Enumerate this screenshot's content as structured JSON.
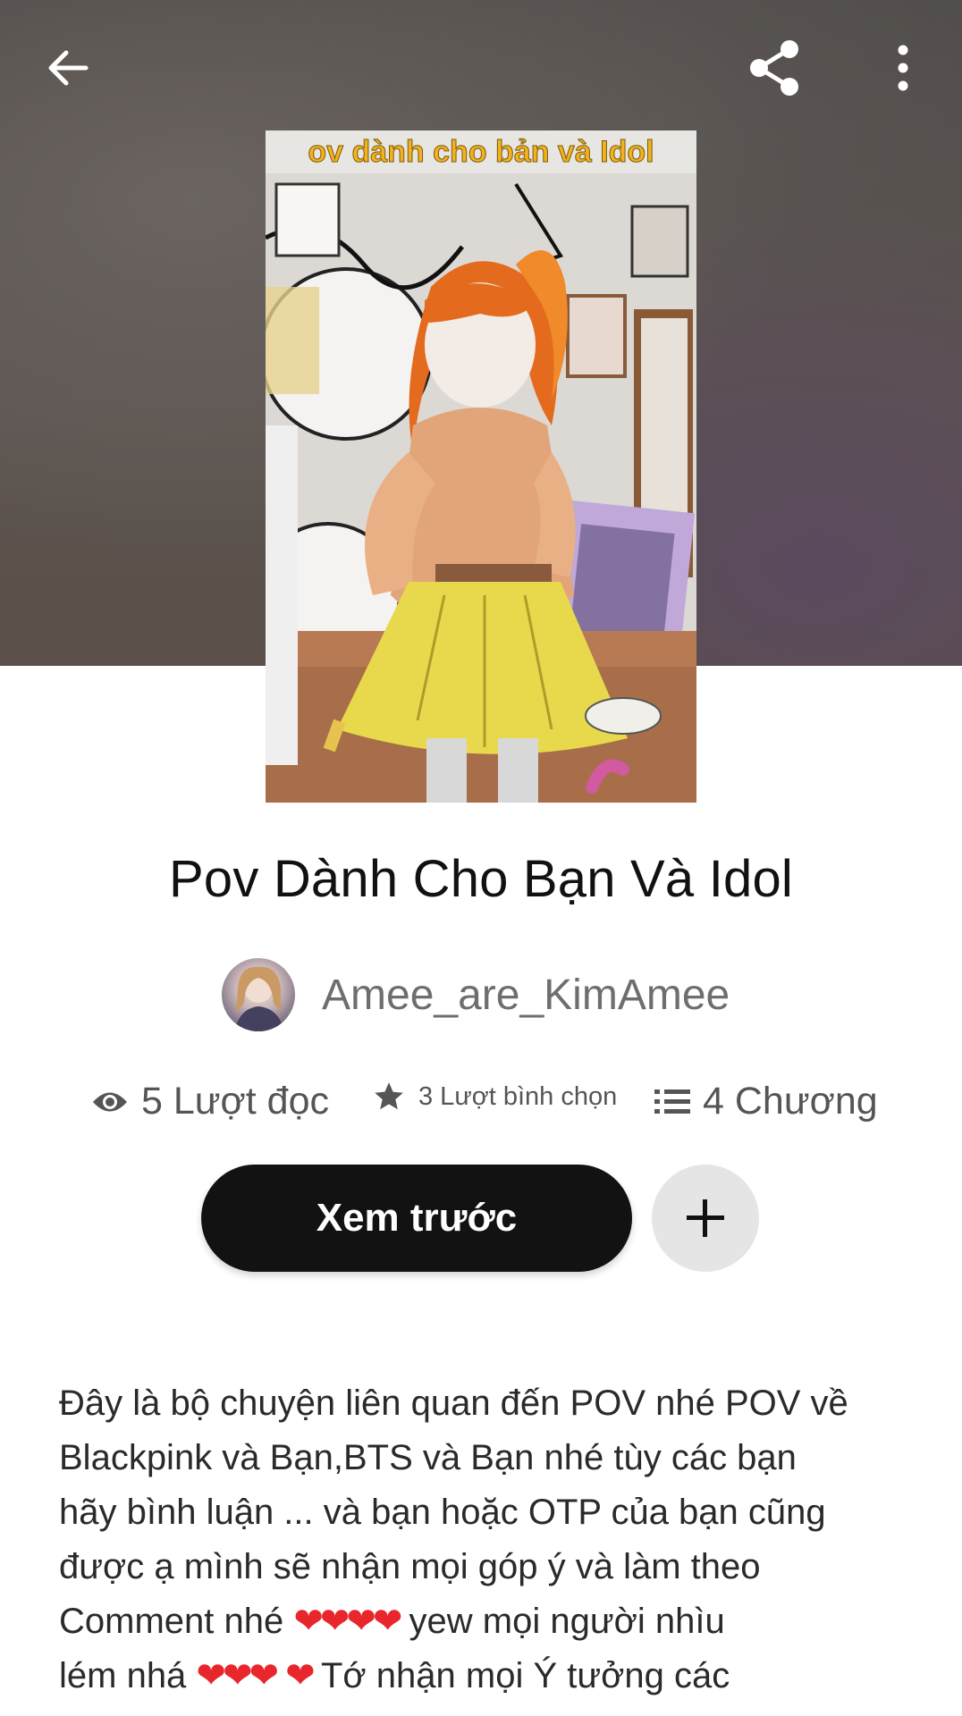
{
  "header": {
    "back_icon": "arrow-left-icon",
    "share_icon": "share-icon",
    "more_icon": "more-vertical-icon"
  },
  "cover": {
    "banner_text": "ov dành cho bản và Idol",
    "alt": "story-cover"
  },
  "story": {
    "title": "Pov Dành Cho Bạn Và Idol",
    "author": "Amee_are_KimAmee"
  },
  "stats": {
    "reads": "5 Lượt đọc",
    "votes": "3 Lượt bình chọn",
    "chapters": "4 Chương"
  },
  "actions": {
    "preview_label": "Xem trước",
    "add_icon": "plus-icon"
  },
  "description": {
    "line1": "Đây là bộ chuyện liên quan đến POV nhé POV về",
    "line2": "Blackpink và Bạn,BTS và Bạn nhé tùy các bạn",
    "line3": "hãy bình luận ... và bạn hoặc OTP của bạn cũng",
    "line4": "được ạ mình sẽ nhận mọi góp ý và làm theo",
    "line5_a": "Comment nhé ",
    "line5_hearts": "❤❤❤❤",
    "line5_b": " yew mọi người nhìu",
    "line6_a": "lém nhá ",
    "line6_hearts": "❤❤❤",
    "line6_heart2": "❤",
    "line6_b": " Tớ nhận mọi Ý tưởng các"
  },
  "colors": {
    "button_bg": "#121212",
    "heart": "#e8262c",
    "hero_bg": "#57504c"
  }
}
